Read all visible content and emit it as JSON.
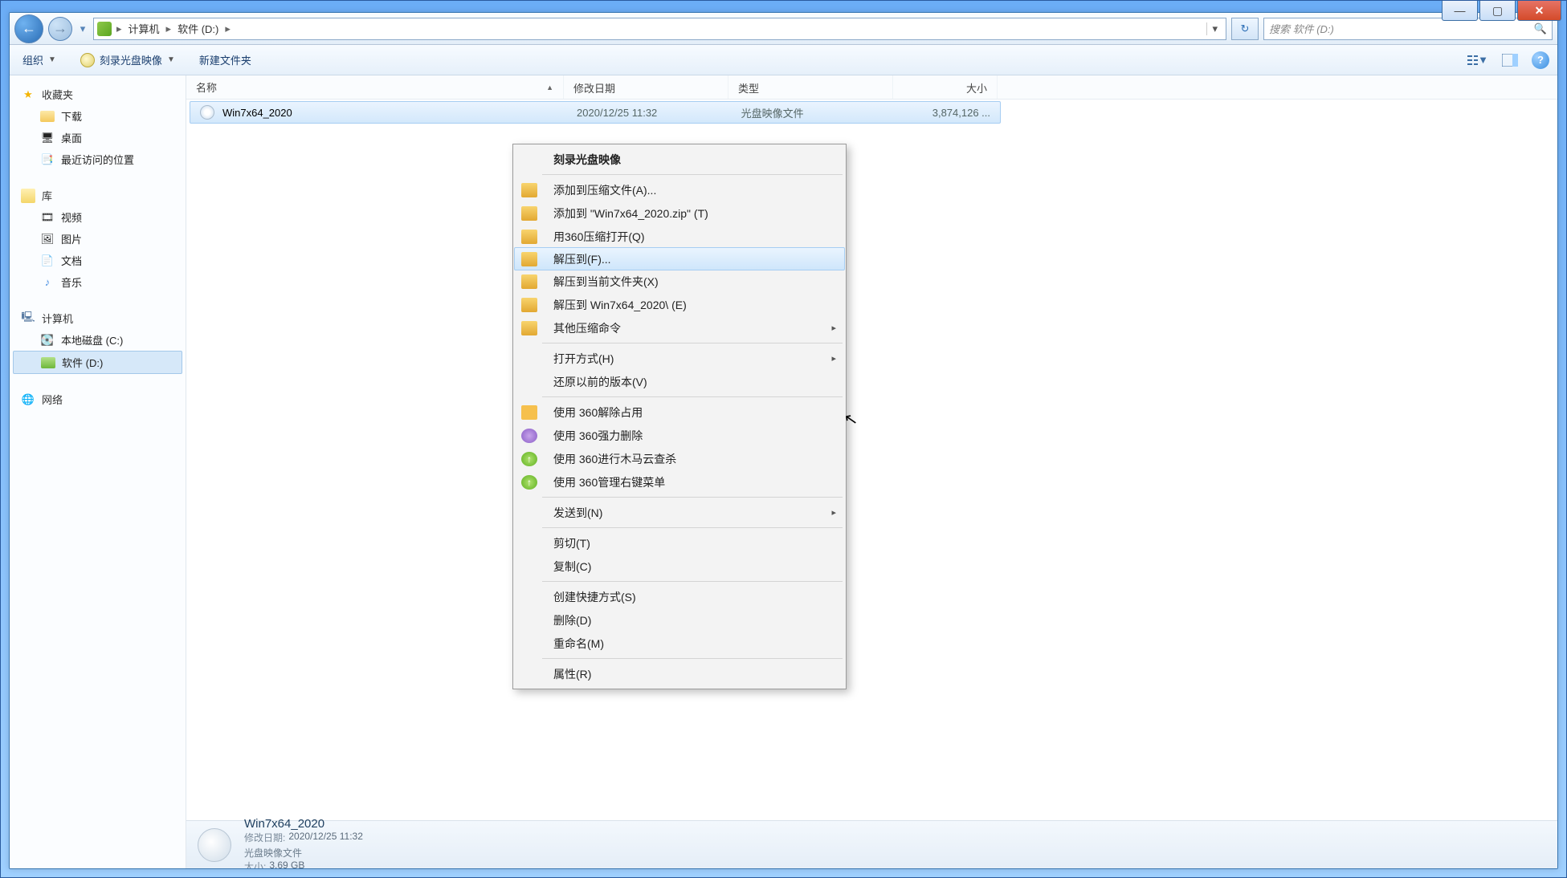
{
  "window": {
    "min": "—",
    "max": "▢",
    "close": "✕"
  },
  "nav": {
    "back_arrow": "←",
    "fwd_arrow": "→",
    "dd": "▾",
    "refresh": "↻",
    "addr_dd": "▾"
  },
  "breadcrumb": {
    "sep1": "▸",
    "item1": "计算机",
    "sep2": "▸",
    "item2": "软件 (D:)",
    "sep3": "▸"
  },
  "search": {
    "placeholder": "搜索 软件 (D:)",
    "icon": "🔍"
  },
  "toolbar": {
    "organize": "组织",
    "organize_dd": "▼",
    "burn": "刻录光盘映像",
    "burn_dd": "▼",
    "newfolder": "新建文件夹",
    "view_dd": "▼",
    "help": "?"
  },
  "sidebar": {
    "favorites": {
      "head": "收藏夹",
      "items": [
        "下载",
        "桌面",
        "最近访问的位置"
      ]
    },
    "libraries": {
      "head": "库",
      "items": [
        "视频",
        "图片",
        "文档",
        "音乐"
      ]
    },
    "computer": {
      "head": "计算机",
      "items": [
        "本地磁盘 (C:)",
        "软件 (D:)"
      ]
    },
    "network": {
      "head": "网络"
    }
  },
  "columns": {
    "name": "名称",
    "date": "修改日期",
    "type": "类型",
    "size": "大小",
    "sort": "▲"
  },
  "file": {
    "name": "Win7x64_2020",
    "date": "2020/12/25 11:32",
    "type": "光盘映像文件",
    "size": "3,874,126 ..."
  },
  "contextmenu": {
    "burn": "刻录光盘映像",
    "add_archive": "添加到压缩文件(A)...",
    "add_zip": "添加到 \"Win7x64_2020.zip\" (T)",
    "open_360zip": "用360压缩打开(Q)",
    "extract_to": "解压到(F)...",
    "extract_here": "解压到当前文件夹(X)",
    "extract_named": "解压到 Win7x64_2020\\ (E)",
    "other_zip": "其他压缩命令",
    "open_with": "打开方式(H)",
    "restore_prev": "还原以前的版本(V)",
    "unlock_360": "使用 360解除占用",
    "force_del_360": "使用 360强力删除",
    "scan_360": "使用 360进行木马云查杀",
    "manage_360": "使用 360管理右键菜单",
    "send_to": "发送到(N)",
    "cut": "剪切(T)",
    "copy": "复制(C)",
    "create_shortcut": "创建快捷方式(S)",
    "delete": "删除(D)",
    "rename": "重命名(M)",
    "properties": "属性(R)",
    "sub_arrow": "▸"
  },
  "details": {
    "title": "Win7x64_2020",
    "type": "光盘映像文件",
    "date_lbl": "修改日期:",
    "date_val": "2020/12/25 11:32",
    "size_lbl": "大小:",
    "size_val": "3.69 GB"
  }
}
